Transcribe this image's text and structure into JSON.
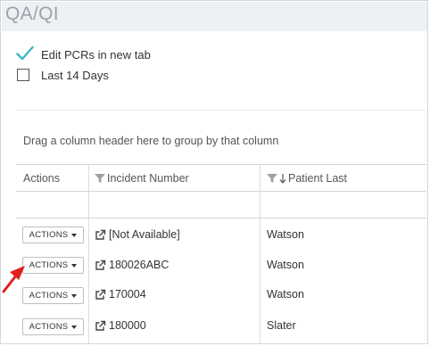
{
  "page": {
    "title": "QA/QI"
  },
  "options": [
    {
      "label": "Edit PCRs in new tab",
      "checked": true
    },
    {
      "label": "Last 14 Days",
      "checked": false
    }
  ],
  "grid": {
    "group_hint": "Drag a column header here to group by that column",
    "columns": [
      {
        "label": "Actions"
      },
      {
        "label": "Incident Number",
        "icon": "filter-icon"
      },
      {
        "label": "Patient Last",
        "icon": "filter-icon",
        "sort": "descending"
      }
    ],
    "rows": [
      {
        "action_label": "ACTIONS",
        "incident": "[Not Available]",
        "patient_last": "Watson"
      },
      {
        "action_label": "ACTIONS",
        "incident": "180026ABC",
        "patient_last": "Watson"
      },
      {
        "action_label": "ACTIONS",
        "incident": "170004",
        "patient_last": "Watson"
      },
      {
        "action_label": "ACTIONS",
        "incident": "180000",
        "patient_last": "Slater"
      }
    ]
  },
  "colors": {
    "check": "#3fb6c6",
    "annotation_arrow": "#e0201c",
    "header_bg": "#eef1f4"
  }
}
